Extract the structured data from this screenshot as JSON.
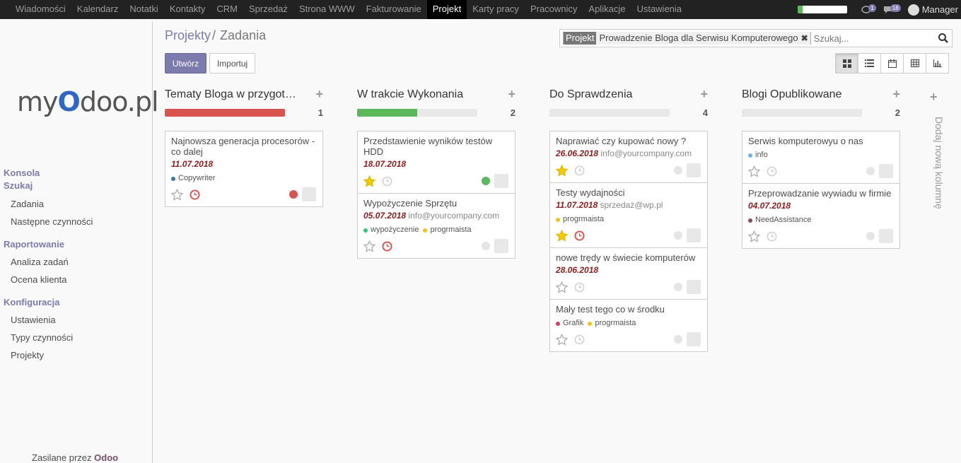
{
  "topbar": {
    "menu": [
      "Wiadomości",
      "Kalendarz",
      "Notatki",
      "Kontakty",
      "CRM",
      "Sprzedaż",
      "Strona WWW",
      "Fakturowanie",
      "Projekt",
      "Karty pracy",
      "Pracownicy",
      "Aplikacje",
      "Ustawienia"
    ],
    "active_menu": "Projekt",
    "progress": 0.1,
    "chat_badge": "1",
    "messages_badge": "18",
    "user_name": "Manager"
  },
  "sidebar": {
    "logo_pre": "my",
    "logo_o": "O",
    "logo_post": "doo.pl",
    "sections": [
      {
        "heading": "Konsola",
        "items": []
      },
      {
        "heading": "Szukaj",
        "items": [
          "Zadania",
          "Następne czynności"
        ]
      },
      {
        "heading": "Raportowanie",
        "items": [
          "Analiza zadań",
          "Ocena klienta"
        ]
      },
      {
        "heading": "Konfiguracja",
        "items": [
          "Ustawienia",
          "Typy czynności",
          "Projekty"
        ]
      }
    ],
    "powered_by": "Zasilane przez",
    "powered_brand": "Odoo"
  },
  "control": {
    "breadcrumb_link": "Projekty",
    "breadcrumb_sep": "/",
    "breadcrumb_current": "Zadania",
    "create_label": "Utwórz",
    "import_label": "Importuj",
    "facet_key": "Projekt",
    "facet_value": "Prowadzenie Bloga dla Serwisu Komputerowego",
    "search_placeholder": "Szukaj...",
    "views": [
      "kanban-icon",
      "list-icon",
      "calendar-icon",
      "pivot-icon",
      "graph-icon"
    ],
    "active_view": "kanban-icon"
  },
  "kanban": {
    "columns": [
      {
        "title": "Tematy Bloga w przygotowaniu",
        "count": "1",
        "progress": 1.0,
        "progress_color": "#d9534f",
        "cards": [
          {
            "title": "Najnowsza generacja procesorów - co dalej",
            "date": "11.07.2018",
            "email": "",
            "tags": [
              {
                "label": "Copywriter",
                "color": "#3c7aa8"
              }
            ],
            "starred": false,
            "deadline_overdue": true,
            "state_color": "#d9534f"
          }
        ]
      },
      {
        "title": "W trakcie Wykonania",
        "count": "2",
        "progress": 0.5,
        "progress_color": "#5cb85c",
        "cards": [
          {
            "title": "Przedstawienie wyników testów HDD",
            "date": "18.07.2018",
            "email": "",
            "tags": [],
            "starred": true,
            "deadline_overdue": false,
            "state_color": "#5cb85c"
          },
          {
            "title": "Wypożyczenie Sprzętu",
            "date": "05.07.2018",
            "email": "info@yourcompany.com",
            "tags": [
              {
                "label": "wypożyczenie",
                "color": "#30c381"
              },
              {
                "label": "progrmaista",
                "color": "#f0c419"
              }
            ],
            "starred": false,
            "deadline_overdue": true,
            "state_color": "#e5e5e5"
          }
        ]
      },
      {
        "title": "Do Sprawdzenia",
        "count": "4",
        "progress": 0,
        "progress_color": "#e8e8e8",
        "cards": [
          {
            "title": "Naprawiać czy kupować nowy ?",
            "date": "26.06.2018",
            "email": "info@yourcompany.com",
            "tags": [],
            "starred": true,
            "deadline_overdue": false,
            "state_color": "#e5e5e5"
          },
          {
            "title": "Testy wydajności",
            "date": "11.07.2018",
            "email": "sprzedaż@wp.pl",
            "tags": [
              {
                "label": "progrmaista",
                "color": "#f0c419"
              }
            ],
            "starred": true,
            "deadline_overdue": true,
            "state_color": "#e5e5e5"
          },
          {
            "title": "nowe trędy w świecie komputerów",
            "date": "28.06.2018",
            "email": "",
            "tags": [],
            "starred": false,
            "deadline_overdue": false,
            "state_color": "#e5e5e5"
          },
          {
            "title": "Mały test tego co w środku",
            "date": "",
            "email": "",
            "tags": [
              {
                "label": "Grafik",
                "color": "#d63a6a"
              },
              {
                "label": "progrmaista",
                "color": "#f0c419"
              }
            ],
            "starred": false,
            "deadline_overdue": false,
            "state_color": "#e5e5e5"
          }
        ]
      },
      {
        "title": "Blogi Opublikowane",
        "count": "2",
        "progress": 0,
        "progress_color": "#e8e8e8",
        "cards": [
          {
            "title": "Serwis komputerowyu o nas",
            "date": "",
            "email": "",
            "tags": [
              {
                "label": "info",
                "color": "#6cb6e6"
              }
            ],
            "starred": false,
            "deadline_overdue": false,
            "state_color": "#e5e5e5"
          },
          {
            "title": "Przeprowadzanie wywiadu w firmie",
            "date": "04.07.2018",
            "email": "",
            "tags": [
              {
                "label": "NeedAssistance",
                "color": "#8a4a6a"
              }
            ],
            "starred": false,
            "deadline_overdue": false,
            "state_color": "#e5e5e5"
          }
        ]
      }
    ],
    "add_column_label": "Dodaj nową kolumnę"
  }
}
